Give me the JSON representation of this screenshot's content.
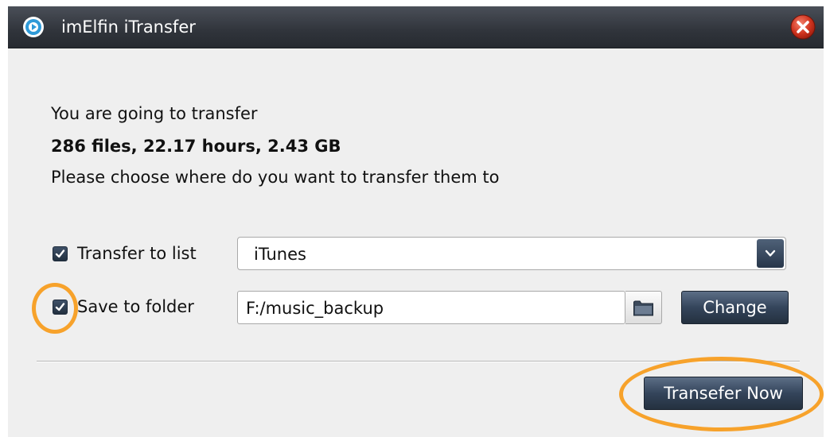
{
  "window": {
    "title": "imElfin iTransfer",
    "app_icon": "play-disc-icon",
    "close_icon": "close-x-icon"
  },
  "summary": {
    "intro": "You are going to transfer",
    "details": "286 files, 22.17 hours, 2.43 GB",
    "prompt": "Please choose where do you want to transfer them to"
  },
  "transfer_to_list": {
    "checked": true,
    "label": "Transfer to list",
    "selected": "iTunes"
  },
  "save_to_folder": {
    "checked": true,
    "label": "Save to folder",
    "path": "F:/music_backup",
    "browse_icon": "folder-icon",
    "change_label": "Change"
  },
  "footer": {
    "transfer_label": "Transefer Now"
  },
  "colors": {
    "titlebar": "#30343b",
    "button": "#34455b",
    "highlight": "#f7a22b",
    "dialog_bg": "#efefef"
  }
}
